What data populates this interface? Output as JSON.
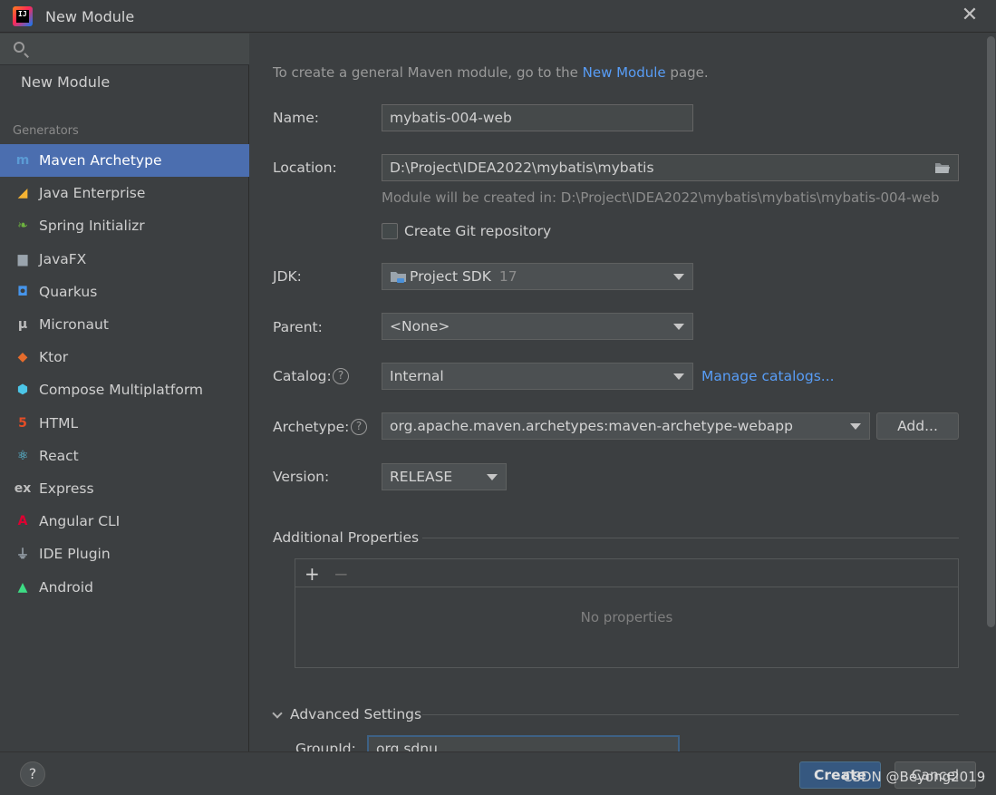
{
  "window": {
    "title": "New Module",
    "close_symbol": "✕"
  },
  "sidebar": {
    "search_placeholder": "",
    "top_item": "New Module",
    "group_label": "Generators",
    "items": [
      {
        "label": "Maven Archetype",
        "icon": "maven-icon",
        "glyph": "m",
        "color": "#5b9bd5",
        "selected": true
      },
      {
        "label": "Java Enterprise",
        "icon": "java-enterprise-icon",
        "glyph": "◢",
        "color": "#f5b333",
        "selected": false
      },
      {
        "label": "Spring Initializr",
        "icon": "spring-icon",
        "glyph": "❧",
        "color": "#6db33f",
        "selected": false
      },
      {
        "label": "JavaFX",
        "icon": "javafx-icon",
        "glyph": "▆",
        "color": "#9aa4ad",
        "selected": false
      },
      {
        "label": "Quarkus",
        "icon": "quarkus-icon",
        "glyph": "◘",
        "color": "#4695eb",
        "selected": false
      },
      {
        "label": "Micronaut",
        "icon": "micronaut-icon",
        "glyph": "μ",
        "color": "#bdbdbd",
        "selected": false
      },
      {
        "label": "Ktor",
        "icon": "ktor-icon",
        "glyph": "◆",
        "color": "#e66c2c",
        "selected": false
      },
      {
        "label": "Compose Multiplatform",
        "icon": "compose-icon",
        "glyph": "⬢",
        "color": "#4cc6e8",
        "selected": false
      },
      {
        "label": "HTML",
        "icon": "html5-icon",
        "glyph": "5",
        "color": "#e44d26",
        "selected": false
      },
      {
        "label": "React",
        "icon": "react-icon",
        "glyph": "⚛",
        "color": "#61dafb",
        "selected": false
      },
      {
        "label": "Express",
        "icon": "express-icon",
        "glyph": "ex",
        "color": "#bdbdbd",
        "selected": false
      },
      {
        "label": "Angular CLI",
        "icon": "angular-icon",
        "glyph": "A",
        "color": "#dd0031",
        "selected": false
      },
      {
        "label": "IDE Plugin",
        "icon": "plugin-icon",
        "glyph": "⏚",
        "color": "#9aa4ad",
        "selected": false
      },
      {
        "label": "Android",
        "icon": "android-icon",
        "glyph": "▲",
        "color": "#3ddc84",
        "selected": false
      }
    ]
  },
  "form": {
    "hint_prefix": "To create a general Maven module, go to the ",
    "hint_link": "New Module",
    "hint_suffix": " page.",
    "name_label": "Name:",
    "name_value": "mybatis-004-web",
    "location_label": "Location:",
    "location_value": "D:\\Project\\IDEA2022\\mybatis\\mybatis",
    "module_path_hint": "Module will be created in: D:\\Project\\IDEA2022\\mybatis\\mybatis\\mybatis-004-web",
    "git_label": "Create Git repository",
    "git_checked": false,
    "jdk_label": "JDK:",
    "jdk_value": "Project SDK",
    "jdk_version": "17",
    "parent_label": "Parent:",
    "parent_value": "<None>",
    "catalog_label": "Catalog:",
    "catalog_value": "Internal",
    "manage_catalogs": "Manage catalogs...",
    "archetype_label": "Archetype:",
    "archetype_value": "org.apache.maven.archetypes:maven-archetype-webapp",
    "add_button": "Add...",
    "version_label": "Version:",
    "version_value": "RELEASE",
    "additional_props_title": "Additional Properties",
    "add_prop": "+",
    "remove_prop": "−",
    "no_props": "No properties",
    "advanced_title": "Advanced Settings",
    "groupid_label": "GroupId:",
    "groupid_value": "org.sdnu"
  },
  "footer": {
    "help": "?",
    "create": "Create",
    "cancel": "Cancel",
    "watermark": "CSDN @Beyong2019"
  },
  "colors": {
    "background": "#3c3f41",
    "selection": "#4b6eaf",
    "link": "#589df6",
    "primary_button": "#365880"
  }
}
